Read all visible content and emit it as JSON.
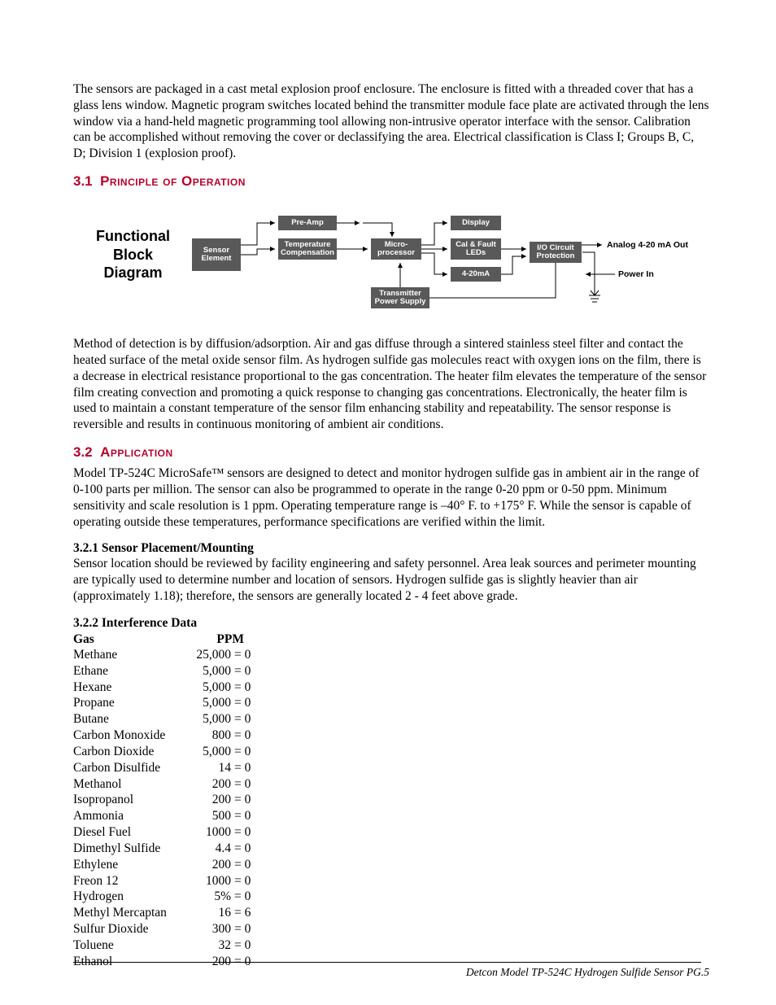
{
  "intro_para": "The sensors are packaged in a cast metal explosion proof enclosure. The enclosure is fitted with a threaded cover that has a glass lens window. Magnetic program switches located behind the transmitter module face plate are activated through the lens window via a hand-held magnetic programming tool allowing non-intrusive operator interface with the sensor. Calibration can be accomplished without removing the cover or declassifying the area. Electrical classification is Class I; Groups B, C, D; Division 1 (explosion proof).",
  "sec31_num": "3.1",
  "sec31_title": "Principle of Operation",
  "diagram_title_l1": "Functional",
  "diagram_title_l2": "Block",
  "diagram_title_l3": "Diagram",
  "blk_sensor": "Sensor\nElement",
  "blk_preamp": "Pre-Amp",
  "blk_temp": "Temperature\nCompensation",
  "blk_micro": "Micro-\nprocessor",
  "blk_display": "Display",
  "blk_cal": "Cal & Fault\nLEDs",
  "blk_420": "4-20mA",
  "blk_power": "Transmitter\nPower Supply",
  "blk_io": "I/O Circuit\nProtection",
  "lbl_analog": "Analog 4-20 mA Out",
  "lbl_powerin": "Power In",
  "para_method": "Method of detection is by diffusion/adsorption. Air and gas diffuse through a sintered stainless steel filter and contact the heated surface of the metal oxide sensor film. As hydrogen sulfide gas molecules react with oxygen ions on the film, there is a decrease in electrical resistance proportional to the gas concentration. The heater film elevates the temperature of the sensor film creating convection and promoting a quick response to changing gas concentrations. Electronically, the heater film is used to maintain a constant temperature of the sensor film enhancing stability and repeatability. The sensor response is reversible and results in continuous monitoring of ambient air conditions.",
  "sec32_num": "3.2",
  "sec32_title": "Application",
  "para_app": "Model TP-524C MicroSafe™ sensors are designed to detect and monitor hydrogen sulfide gas in ambient air in the range of 0-100 parts per million. The sensor can also be programmed to operate in the range 0-20 ppm or 0-50 ppm. Minimum sensitivity and scale resolution is 1 ppm. Operating temperature range is –40° F. to +175° F. While the sensor is capable of operating outside these temperatures, performance specifications are verified within the limit.",
  "sub321": "3.2.1  Sensor Placement/Mounting",
  "para_placement": "Sensor location should be reviewed by facility engineering and safety personnel. Area leak sources and perimeter mounting are typically used to determine number and location of sensors. Hydrogen sulfide gas is slightly heavier than air (approximately 1.18); therefore, the sensors are generally located 2 - 4 feet above grade.",
  "sub322": "3.2.2  Interference Data",
  "hdr_gas": "Gas",
  "hdr_ppm": "PPM",
  "interference": [
    {
      "gas": "Methane",
      "val": "25,000",
      "eq": "= 0"
    },
    {
      "gas": "Ethane",
      "val": "5,000",
      "eq": "= 0"
    },
    {
      "gas": "Hexane",
      "val": "5,000",
      "eq": "= 0"
    },
    {
      "gas": "Propane",
      "val": "5,000",
      "eq": "= 0"
    },
    {
      "gas": "Butane",
      "val": "5,000",
      "eq": "= 0"
    },
    {
      "gas": "Carbon Monoxide",
      "val": "800",
      "eq": "= 0"
    },
    {
      "gas": "Carbon Dioxide",
      "val": "5,000",
      "eq": "= 0"
    },
    {
      "gas": "Carbon Disulfide",
      "val": "14",
      "eq": "= 0"
    },
    {
      "gas": "Methanol",
      "val": "200",
      "eq": "= 0"
    },
    {
      "gas": "Isopropanol",
      "val": "200",
      "eq": "= 0"
    },
    {
      "gas": "Ammonia",
      "val": "500",
      "eq": "= 0"
    },
    {
      "gas": "Diesel Fuel",
      "val": "1000",
      "eq": "= 0"
    },
    {
      "gas": "Dimethyl Sulfide",
      "val": "4.4",
      "eq": "= 0"
    },
    {
      "gas": "Ethylene",
      "val": "200",
      "eq": "= 0"
    },
    {
      "gas": "Freon 12",
      "val": "1000",
      "eq": "= 0"
    },
    {
      "gas": "Hydrogen",
      "val": "5%",
      "eq": "= 0"
    },
    {
      "gas": "Methyl Mercaptan",
      "val": "16",
      "eq": "= 6"
    },
    {
      "gas": "Sulfur Dioxide",
      "val": "300",
      "eq": "= 0"
    },
    {
      "gas": "Toluene",
      "val": "32",
      "eq": "= 0"
    },
    {
      "gas": "Ethanol",
      "val": "200",
      "eq": "= 0"
    }
  ],
  "footer": "Detcon Model TP-524C Hydrogen Sulfide Sensor   PG.5"
}
